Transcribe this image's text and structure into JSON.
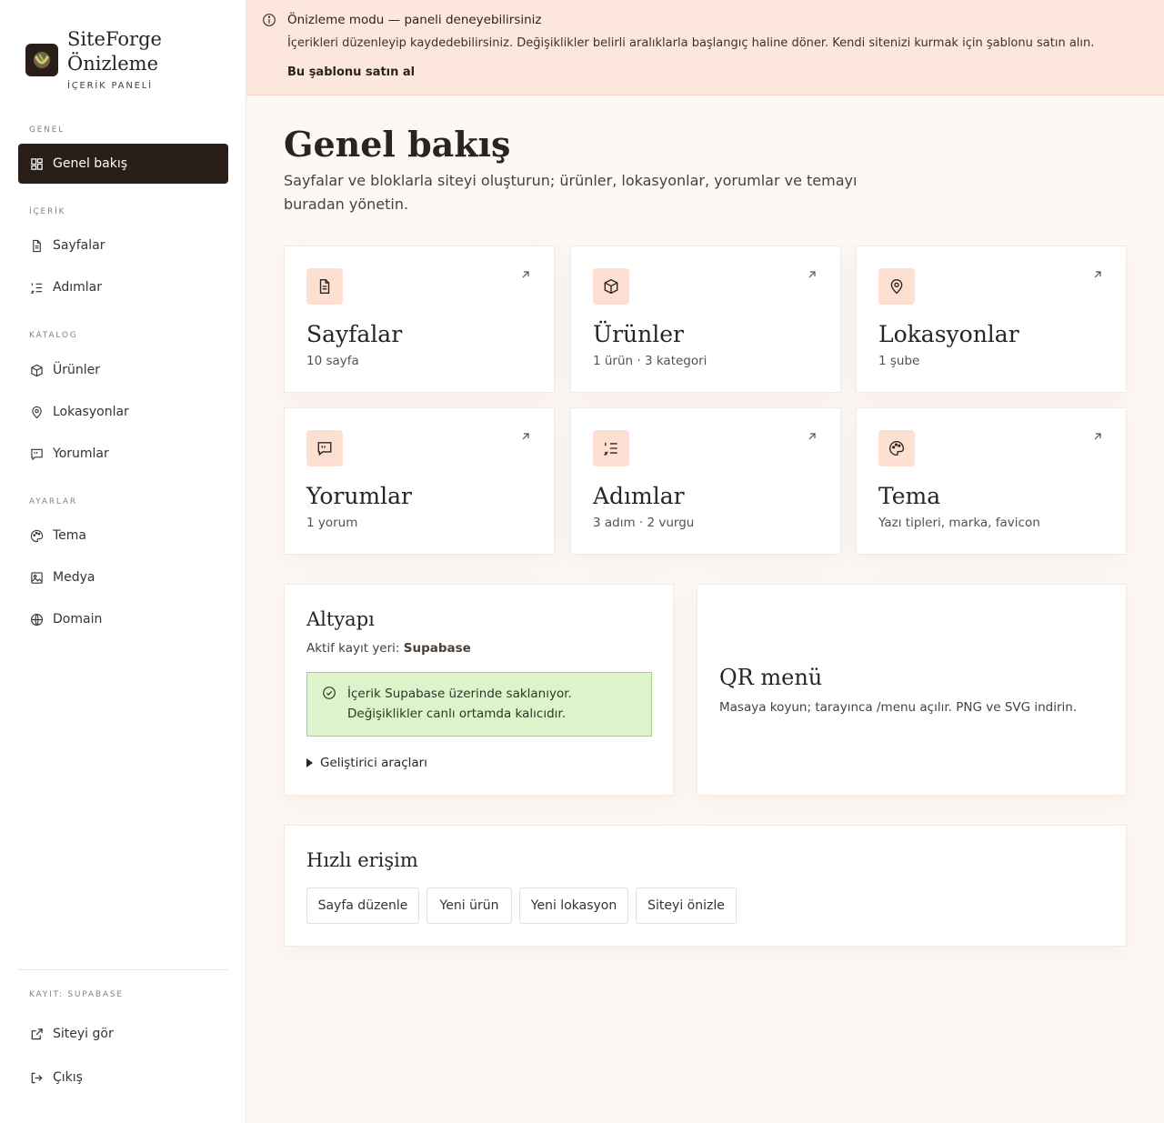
{
  "brand": {
    "title": "SiteForge Önizleme",
    "subtitle": "İÇERİK PANELİ"
  },
  "sidebar": {
    "sections": [
      {
        "label": "GENEL"
      },
      {
        "label": "İÇERİK"
      },
      {
        "label": "KATALOG"
      },
      {
        "label": "AYARLAR"
      }
    ],
    "items": [
      {
        "label": "Genel bakış",
        "icon": "dashboard-icon",
        "active": true
      },
      {
        "label": "Sayfalar",
        "icon": "file-icon"
      },
      {
        "label": "Adımlar",
        "icon": "list-ordered-icon"
      },
      {
        "label": "Ürünler",
        "icon": "box-icon"
      },
      {
        "label": "Lokasyonlar",
        "icon": "map-pin-icon"
      },
      {
        "label": "Yorumlar",
        "icon": "message-quote-icon"
      },
      {
        "label": "Tema",
        "icon": "palette-icon"
      },
      {
        "label": "Medya",
        "icon": "image-icon"
      },
      {
        "label": "Domain",
        "icon": "globe-icon"
      }
    ],
    "footer_label": "KAYIT: SUPABASE",
    "footer_items": [
      {
        "label": "Siteyi gör",
        "icon": "external-link-icon"
      },
      {
        "label": "Çıkış",
        "icon": "logout-icon"
      }
    ]
  },
  "banner": {
    "title": "Önizleme modu — paneli deneyebilirsiniz",
    "text": "İçerikleri düzenleyip kaydedebilirsiniz. Değişiklikler belirli aralıklarla başlangıç haline döner. Kendi sitenizi kurmak için şablonu satın alın.",
    "link": "Bu şablonu satın al"
  },
  "main": {
    "title": "Genel bakış",
    "description": "Sayfalar ve bloklarla siteyi oluşturun; ürünler, lokasyonlar, yorumlar ve temayı buradan yönetin.",
    "cards": [
      {
        "title": "Sayfalar",
        "subtitle": "10 sayfa",
        "icon": "file-icon"
      },
      {
        "title": "Ürünler",
        "subtitle": "1 ürün · 3 kategori",
        "icon": "box-icon"
      },
      {
        "title": "Lokasyonlar",
        "subtitle": "1 şube",
        "icon": "map-pin-icon"
      },
      {
        "title": "Yorumlar",
        "subtitle": "1 yorum",
        "icon": "message-quote-icon"
      },
      {
        "title": "Adımlar",
        "subtitle": "3 adım · 2 vurgu",
        "icon": "list-ordered-icon"
      },
      {
        "title": "Tema",
        "subtitle": "Yazı tipleri, marka, favicon",
        "icon": "palette-icon"
      }
    ],
    "infra": {
      "title": "Altyapı",
      "storage_label": "Aktif kayıt yeri:",
      "storage_value": "Supabase",
      "notice": "İçerik Supabase üzerinde saklanıyor. Değişiklikler canlı ortamda kalıcıdır.",
      "details_label": "Geliştirici araçları"
    },
    "qr": {
      "title": "QR menü",
      "description": "Masaya koyun; tarayınca /menu açılır. PNG ve SVG indirin."
    },
    "quick": {
      "title": "Hızlı erişim",
      "buttons": [
        "Sayfa düzenle",
        "Yeni ürün",
        "Yeni lokasyon",
        "Siteyi önizle"
      ]
    }
  },
  "colors": {
    "accent_dark": "#2a1f18",
    "banner_bg": "#fde7dc",
    "icon_bg": "#fde0d2",
    "success_bg": "#dcf3cb",
    "success_border": "#9fd386"
  }
}
